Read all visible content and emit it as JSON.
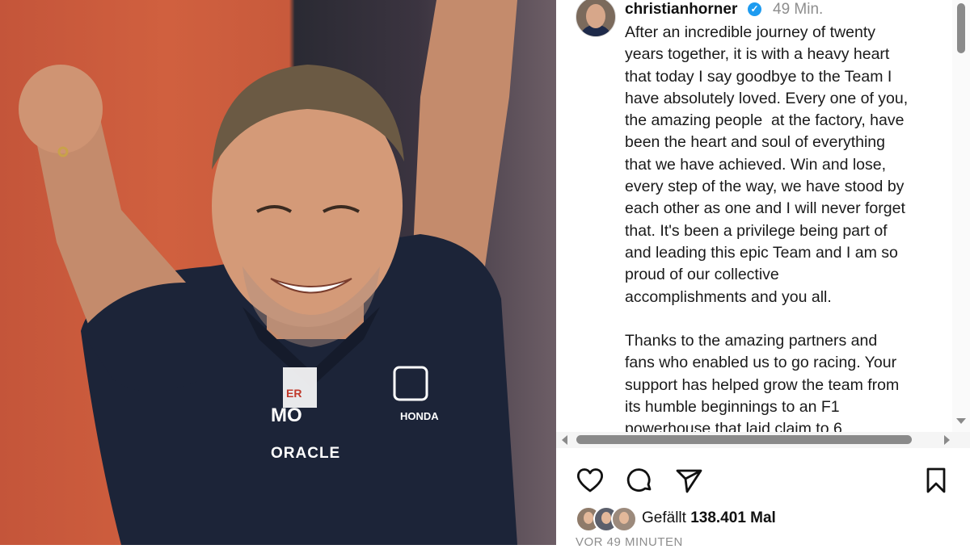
{
  "post": {
    "username": "christianhorner",
    "verified_icon": "verified-badge-icon",
    "time": "49 Min.",
    "caption": "After an incredible journey of twenty\nyears together, it is with a heavy heart\nthat today I say goodbye to the Team I\nhave absolutely loved. Every one of you,\nthe amazing people  at the factory, have\nbeen the heart and soul of everything\nthat we have achieved. Win and lose,\nevery step of the way, we have stood by\neach other as one and I will never forget\nthat. It's been a privilege being part of\nand leading this epic Team and I am so\nproud of our collective\naccomplishments and you all.\n\nThanks to the amazing partners and\nfans who enabled us to go racing. Your\nsupport has helped grow the team from\nits humble beginnings to an F1\npowerhouse that laid claim to 6"
  },
  "actions": {
    "like_icon": "heart-icon",
    "comment_icon": "comment-icon",
    "share_icon": "send-icon",
    "save_icon": "bookmark-icon"
  },
  "likes": {
    "prefix": "Gefällt ",
    "count": "138.401 Mal"
  },
  "timestamp": "VOR 49 MINUTEN",
  "photo": {
    "shirt_text_1": "MO",
    "shirt_text_2": "ORACLE",
    "shirt_text_3": "HONDA",
    "shirt_text_4": "ER"
  },
  "colors": {
    "verified": "#1d9bf0",
    "shirt": "#1c2438",
    "background_orange": "#c85a3c"
  }
}
